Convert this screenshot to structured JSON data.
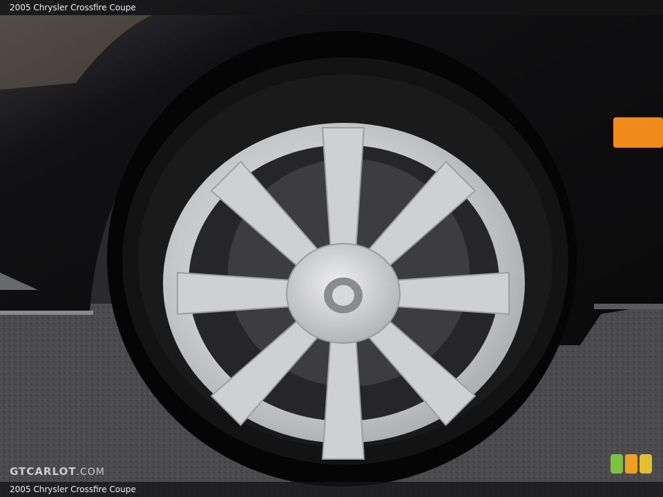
{
  "header": {
    "title": "2005 Chrysler Crossfire Coupe"
  },
  "footer": {
    "caption": "2005 Chrysler Crossfire Coupe"
  },
  "watermark": {
    "brand": "GTCARLOT",
    "suffix": ".COM"
  },
  "photo": {
    "subject": "wheel-photo"
  },
  "colors": {
    "bar_bg": "#141416",
    "car_paint": "#0f0f11",
    "tire": "#111112",
    "rim_silver": "#c9cacc",
    "asphalt": "#4c4c4f",
    "marker_light": "#f08a1a",
    "badge_green": "#7cc242",
    "badge_orange": "#f0a020",
    "badge_yellow": "#e0c030"
  }
}
